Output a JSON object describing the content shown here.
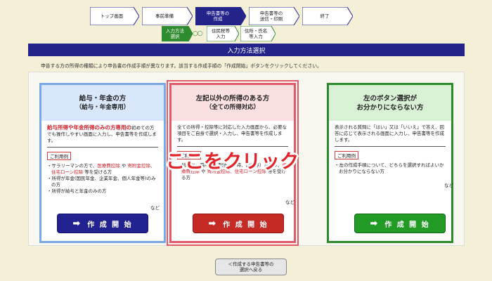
{
  "steps": [
    {
      "label": "トップ画面",
      "active": false
    },
    {
      "label": "事前準備",
      "active": false
    },
    {
      "label": "申告書等の\n作成",
      "active": true
    },
    {
      "label": "申告書等の\n送信・印刷",
      "active": false
    },
    {
      "label": "終了",
      "active": false
    }
  ],
  "substeps": [
    {
      "label": "入力方法\n選択",
      "active": true
    },
    {
      "label": "住民税等\n入力",
      "active": false
    },
    {
      "label": "住所・氏名\n等入力",
      "active": false
    }
  ],
  "dots": "○○",
  "title_bar": "入力方法選択",
  "instruction": "申告する方の所得の種類により申告書の作成手順が異なります。該当する作成手順の「作成開始」ボタンをクリックしてください。",
  "cards": [
    {
      "title1": "給与・年金の方",
      "title2": "（給与・年金専用）",
      "lead_red": "給与所得や年金所得のみの方専用の",
      "lead_rest": "初めての方でも操作しやすい画面に入力し、申告書等を作成します。",
      "example_label": "ご利用例",
      "examples": [
        {
          "pre": "・サラリーマンの方で、",
          "red": "医療費控除",
          "mid": " や ",
          "red2": "寄附金控除、住宅ローン控除",
          "post": " 等を受ける方"
        },
        {
          "pre": "・所得が年金(国民年金、企業年金、個人年金等)のみの方",
          "red": "",
          "mid": "",
          "red2": "",
          "post": ""
        },
        {
          "pre": "・所得が給与と年金のみの方",
          "red": "",
          "mid": "",
          "red2": "",
          "post": ""
        }
      ],
      "nado": "など",
      "button": "作 成 開 始",
      "accent": "#222290"
    },
    {
      "title1": "左記以外の所得のある方",
      "title2": "（全ての所得対応）",
      "lead_red": "",
      "lead_rest": "全ての所得・控除等に対応した入力画面から、必要な項目をご自身で選択・入力し、申告書等を作成します。",
      "example_label": "ご利用例",
      "examples": [
        {
          "pre": "・給与と一時所得（配当・一時、譲渡等）があり、",
          "red": "医療費控除",
          "mid": " や ",
          "red2": "寄附金控除、住宅ローン控除",
          "post": " 等を受ける方"
        }
      ],
      "nado": "など",
      "button": "作 成 開 始",
      "accent": "#c62a24"
    },
    {
      "title1": "左のボタン選択が",
      "title2": "お分かりにならない方",
      "lead_red": "",
      "lead_rest": "表示される質問に「はい」又は「いいえ」で答え、回答に応じて表示される画面に入力し、申告書等を作成します。",
      "example_label": "ご利用例",
      "examples": [
        {
          "pre": "・左の作成手順について、どちらを選択すればよいかお分かりにならない方",
          "red": "",
          "mid": "",
          "red2": "",
          "post": ""
        }
      ],
      "nado": "など",
      "button": "作 成 開 始",
      "accent": "#229a26"
    }
  ],
  "overlay_text": "ここをクリック",
  "back_button": "＜作成する申告書等の\n選択へ戻る"
}
